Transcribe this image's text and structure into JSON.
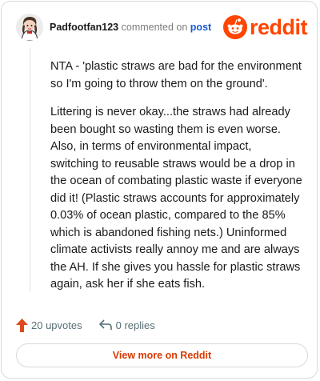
{
  "comment": {
    "username": "Padfootfan123",
    "action_text": "commented on",
    "post_link": "post",
    "paragraphs": [
      "NTA - 'plastic straws are bad for the environment so I'm going to throw them on the ground'.",
      "Littering is never okay...the straws had already been bought so wasting them is even worse. Also, in terms of environmental impact, switching to reusable straws would be a drop in the ocean of combating plastic waste if everyone did it! (Plastic straws accounts for approximately 0.03% of ocean plastic, compared to the 85% which is abandoned fishing nets.) Uninformed climate activists really annoy me and are always the AH. If she gives you hassle for plastic straws again, ask her if she eats fish."
    ]
  },
  "logo": {
    "wordmark": "reddit",
    "icon": "snoo-icon"
  },
  "actions": {
    "upvotes_label": "20 upvotes",
    "replies_label": "0 replies"
  },
  "view_more_label": "View more on Reddit",
  "colors": {
    "brand": "#ff4500",
    "link": "#1a5ad2",
    "button_text": "#d93900",
    "upvote": "#e0481d"
  }
}
